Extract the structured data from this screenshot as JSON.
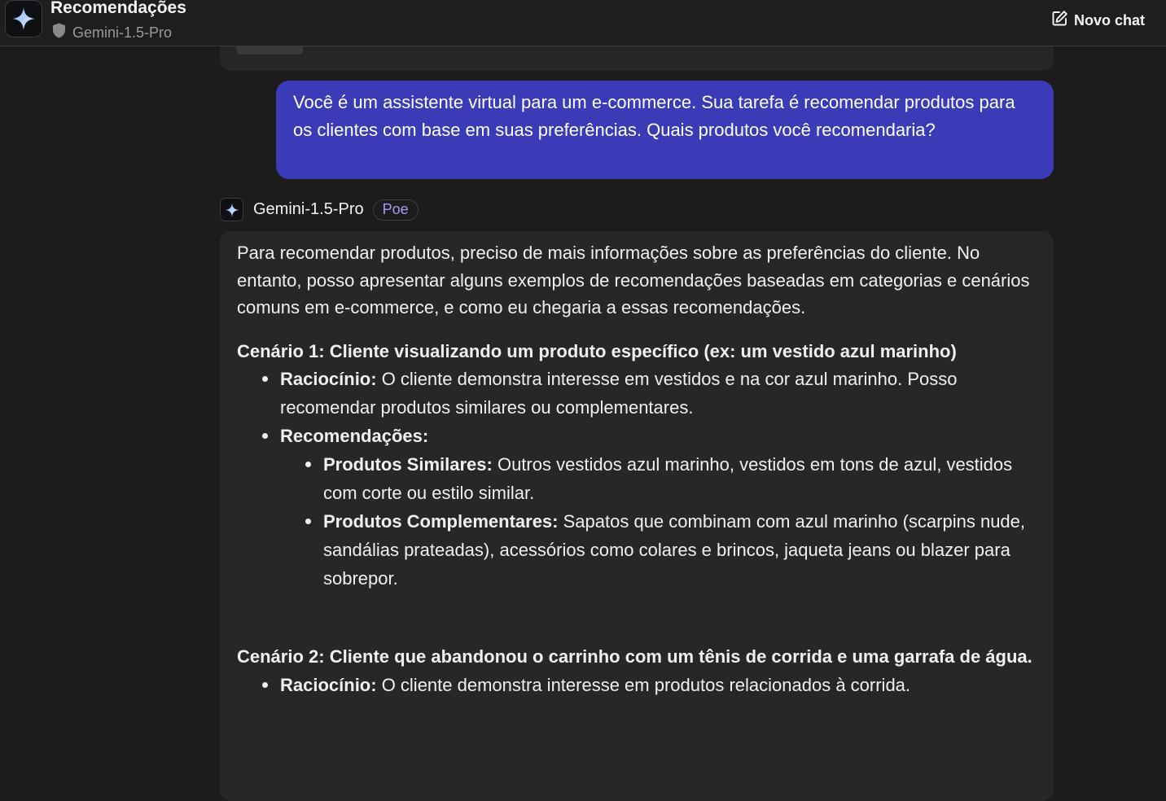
{
  "header": {
    "title": "Recomendações",
    "model": "Gemini-1.5-Pro",
    "new_chat": "Novo chat"
  },
  "conversation": {
    "user_message": "Você é um assistente virtual para um e-commerce. Sua tarefa é recomendar produtos para os clientes com base em suas preferências. Quais produtos você recomendaria?",
    "bot_name": "Gemini-1.5-Pro",
    "bot_badge": "Poe",
    "response": {
      "intro": "Para recomendar produtos, preciso de mais informações sobre as preferências do cliente. No entanto, posso apresentar alguns exemplos de recomendações baseadas em categorias e cenários comuns em e-commerce, e como eu chegaria a essas recomendações.",
      "scenario1": {
        "heading": "Cenário 1: Cliente visualizando um produto específico (ex: um vestido azul marinho)",
        "reasoning_label": "Raciocínio:",
        "reasoning_text": " O cliente demonstra interesse em vestidos e na cor azul marinho. Posso recomendar produtos similares ou complementares.",
        "recs_label": "Recomendações:",
        "similar_label": "Produtos Similares:",
        "similar_text": " Outros vestidos azul marinho, vestidos em tons de azul, vestidos com corte ou estilo similar.",
        "complementary_label": "Produtos Complementares:",
        "complementary_text": " Sapatos que combinam com azul marinho (scarpins nude, sandálias prateadas), acessórios como colares e brincos, jaqueta jeans ou blazer para sobrepor."
      },
      "scenario2": {
        "heading": "Cenário 2: Cliente que abandonou o carrinho com um tênis de corrida e uma garrafa de água.",
        "reasoning_label": "Raciocínio:",
        "reasoning_text": " O cliente demonstra interesse em produtos relacionados à corrida."
      }
    }
  },
  "colors": {
    "background": "#1c1c1c",
    "card": "#272727",
    "user_bubble": "#3b3bb8",
    "badge_text": "#a39af5"
  }
}
